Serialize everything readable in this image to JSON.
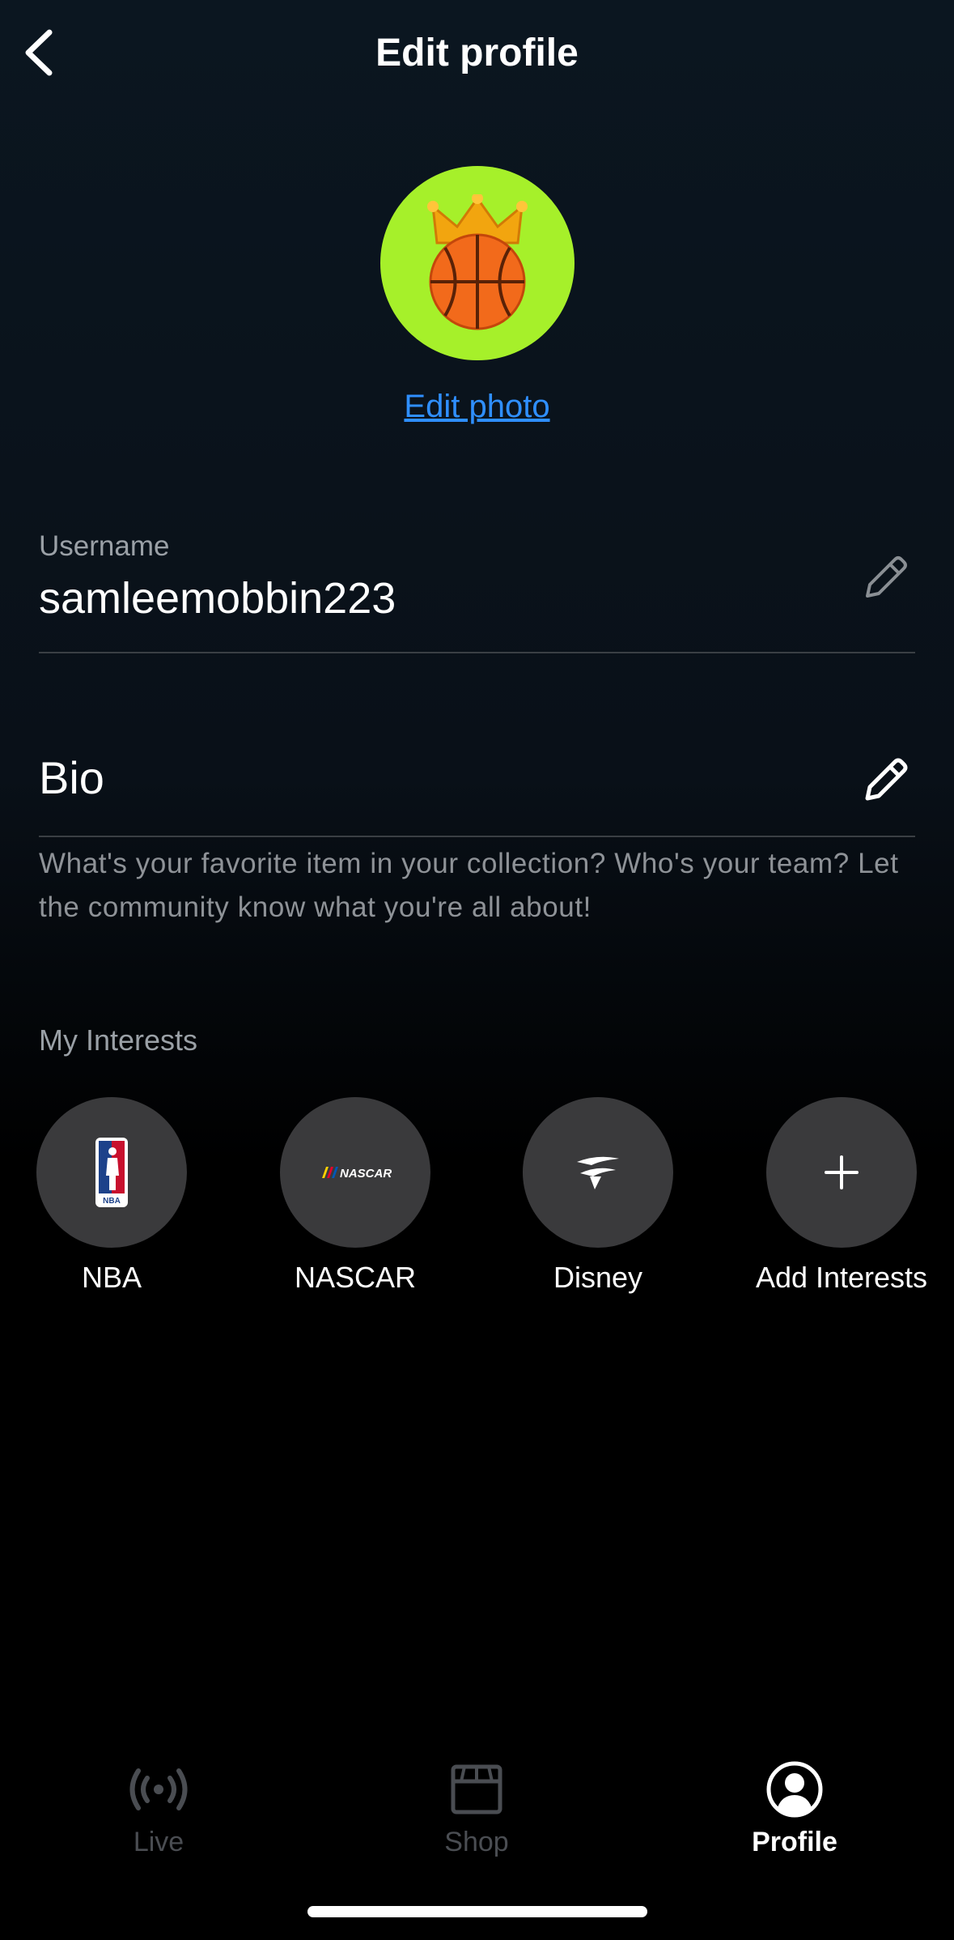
{
  "header": {
    "title": "Edit profile"
  },
  "profile": {
    "edit_photo_label": "Edit photo",
    "username_label": "Username",
    "username_value": "samleemobbin223",
    "bio_label": "Bio",
    "bio_placeholder": "What's your favorite item in your collection? Who's your team? Let the community know what you're all about!"
  },
  "interests": {
    "label": "My Interests",
    "items": [
      {
        "label": "NBA",
        "icon": "nba-logo-icon"
      },
      {
        "label": "NASCAR",
        "icon": "nascar-logo-icon"
      },
      {
        "label": "Disney",
        "icon": "disney-logo-icon"
      },
      {
        "label": "Add Interests",
        "icon": "plus-icon"
      }
    ]
  },
  "tabbar": {
    "tabs": [
      {
        "label": "Live",
        "icon": "live-broadcast-icon",
        "active": false
      },
      {
        "label": "Shop",
        "icon": "shop-icon",
        "active": false
      },
      {
        "label": "Profile",
        "icon": "profile-icon",
        "active": true
      }
    ]
  },
  "colors": {
    "avatar_bg": "#a6f02a",
    "link": "#2f8fff",
    "interest_circle": "#3a3a3c"
  }
}
